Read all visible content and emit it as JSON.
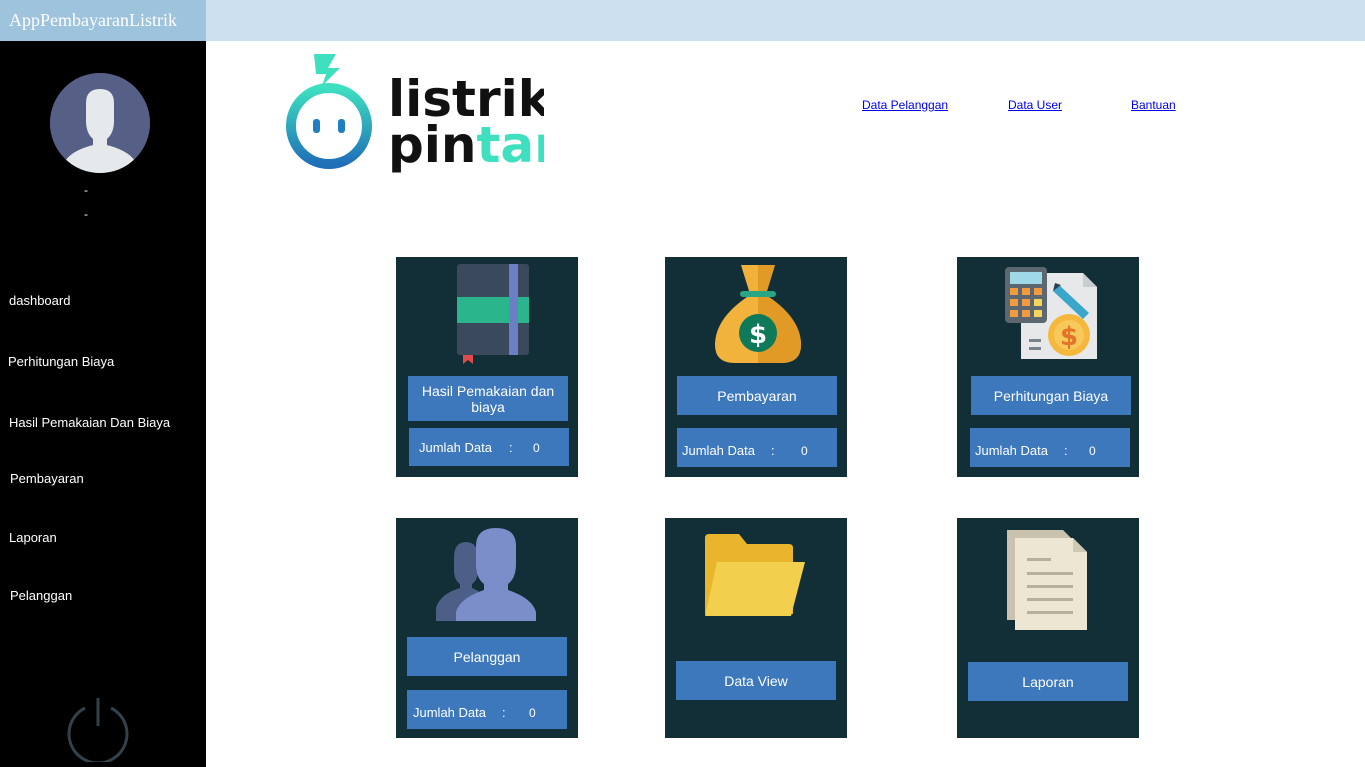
{
  "app": {
    "title": "AppPembayaranListrik"
  },
  "user": {
    "name": "-",
    "role": "-"
  },
  "sidebar": {
    "items": [
      {
        "label": "dashboard"
      },
      {
        "label": "Perhitungan Biaya"
      },
      {
        "label": "Hasil Pemakaian Dan Biaya"
      },
      {
        "label": "Pembayaran"
      },
      {
        "label": "Laporan"
      },
      {
        "label": "Pelanggan"
      }
    ]
  },
  "logo": {
    "line1": "listrik",
    "line2a": "pin",
    "line2b": "tar"
  },
  "toplinks": [
    "Data Pelanggan",
    "Data User",
    "Bantuan"
  ],
  "cards": {
    "hasil": {
      "label": "Hasil Pemakaian dan biaya",
      "count_label": "Jumlah Data",
      "sep": ":",
      "count": "0"
    },
    "bayar": {
      "label": "Pembayaran",
      "count_label": "Jumlah Data",
      "sep": ":",
      "count": "0"
    },
    "hitung": {
      "label": "Perhitungan Biaya",
      "count_label": "Jumlah Data",
      "sep": ":",
      "count": "0"
    },
    "pelanggan": {
      "label": "Pelanggan",
      "count_label": "Jumlah Data",
      "sep": ":",
      "count": "0"
    },
    "dataview": {
      "label": "Data View"
    },
    "laporan": {
      "label": "Laporan"
    }
  },
  "colors": {
    "sidebar": "#000000",
    "card": "#122e37",
    "button": "#3c78bb",
    "topbar": "#cde0ef",
    "accent": "#3ee0c0"
  },
  "icons": [
    "user-avatar-icon",
    "power-icon",
    "notebook-icon",
    "money-bag-icon",
    "calculator-bill-icon",
    "users-icon",
    "folder-icon",
    "document-icon"
  ]
}
